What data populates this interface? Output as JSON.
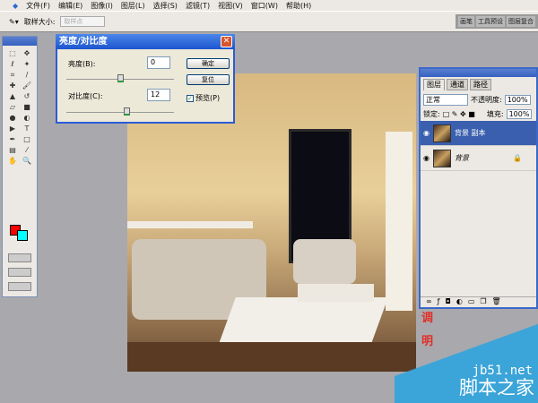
{
  "menu": [
    "文件(F)",
    "编辑(E)",
    "图像(I)",
    "图层(L)",
    "选择(S)",
    "滤镜(T)",
    "视图(V)",
    "窗口(W)",
    "帮助(H)"
  ],
  "options": {
    "sample_label": "取样大小:",
    "sample_value": "取样点"
  },
  "wells": [
    "画笔",
    "工具预设",
    "图层复合"
  ],
  "dialog": {
    "title": "亮度/对比度",
    "brightness_label": "亮度(B):",
    "brightness_value": "0",
    "brightness_pct": 50,
    "contrast_label": "对比度(C):",
    "contrast_value": "12",
    "contrast_pct": 56,
    "ok": "确定",
    "reset": "复位",
    "preview": "预览(P)"
  },
  "layers": {
    "tabs": [
      "图层",
      "通道",
      "路径"
    ],
    "mode": "正常",
    "opacity_label": "不透明度:",
    "opacity": "100%",
    "lock_label": "锁定:",
    "fill_label": "填充:",
    "fill": "100%",
    "items": [
      {
        "name": "背景 副本"
      },
      {
        "name": "背景"
      }
    ]
  },
  "caption": [
    "调",
    "明"
  ],
  "watermark": {
    "url": "jb51.net",
    "name": "脚本之家"
  }
}
